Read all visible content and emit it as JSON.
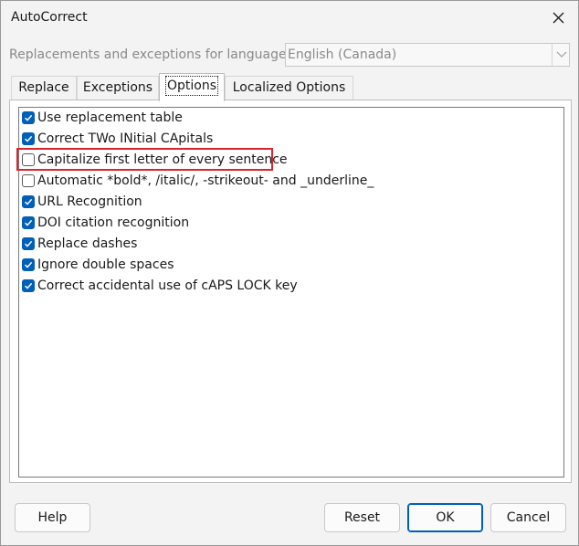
{
  "window": {
    "title": "AutoCorrect"
  },
  "language": {
    "label": "Replacements and exceptions for language:",
    "selected": "English (Canada)"
  },
  "tabs": [
    {
      "label": "Replace",
      "active": false
    },
    {
      "label": "Exceptions",
      "active": false
    },
    {
      "label": "Options",
      "active": true
    },
    {
      "label": "Localized Options",
      "active": false
    }
  ],
  "options": [
    {
      "label": "Use replacement table",
      "checked": true
    },
    {
      "label": "Correct TWo INitial CApitals",
      "checked": true
    },
    {
      "label": "Capitalize first letter of every sentence",
      "checked": false,
      "highlighted": true
    },
    {
      "label": "Automatic *bold*, /italic/, -strikeout- and _underline_",
      "checked": false
    },
    {
      "label": "URL Recognition",
      "checked": true
    },
    {
      "label": "DOI citation recognition",
      "checked": true
    },
    {
      "label": "Replace dashes",
      "checked": true
    },
    {
      "label": "Ignore double spaces",
      "checked": true
    },
    {
      "label": "Correct accidental use of cAPS LOCK key",
      "checked": true
    }
  ],
  "buttons": {
    "help": "Help",
    "reset": "Reset",
    "ok": "OK",
    "cancel": "Cancel"
  },
  "colors": {
    "accent": "#005fb8",
    "highlight": "#d9252e"
  }
}
